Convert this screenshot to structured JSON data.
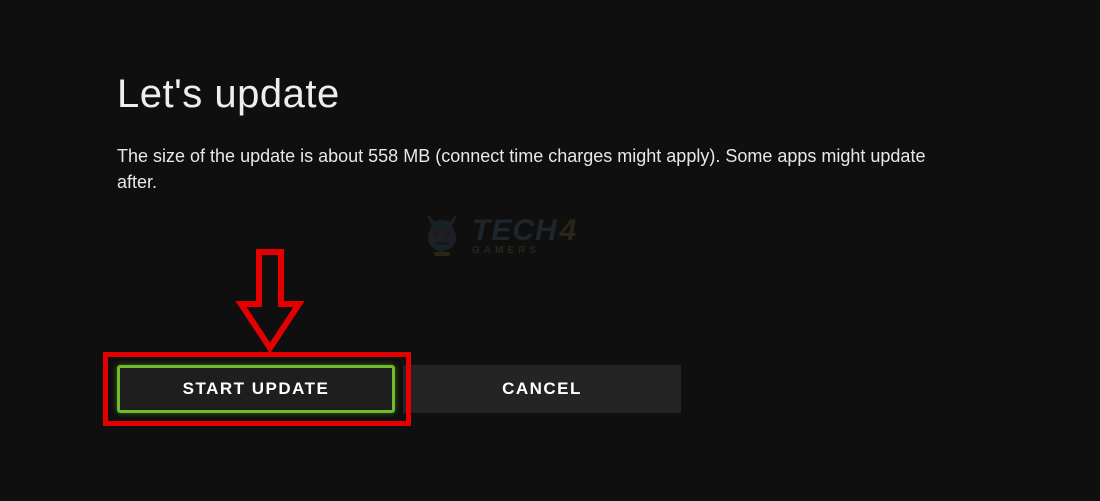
{
  "dialog": {
    "title": "Let's update",
    "description": "The size of the update is about 558 MB (connect time charges might apply). Some apps might update after."
  },
  "buttons": {
    "primary": "START UPDATE",
    "secondary": "CANCEL"
  },
  "watermark": {
    "text_main": "TECH",
    "text_accent": "4",
    "text_sub": "GAMERS"
  },
  "colors": {
    "background": "#0f0f0f",
    "accent_green": "#6fbb2a",
    "annotation_red": "#e40000"
  }
}
